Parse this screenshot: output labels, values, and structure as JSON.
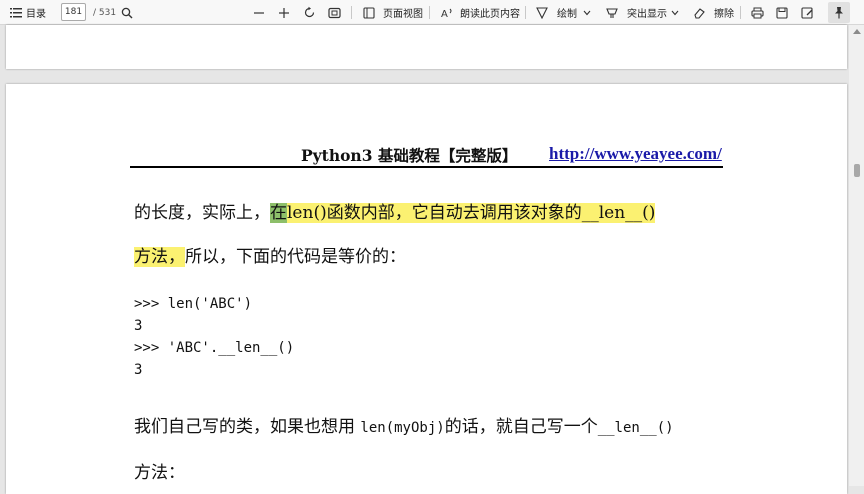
{
  "toolbar": {
    "toc_label": "目录",
    "current_page": "181",
    "total_pages": "/ 531",
    "page_view_label": "页面视图",
    "read_aloud_label": "朗读此页内容",
    "draw_label": "绘制",
    "highlight_label": "突出显示",
    "erase_label": "擦除"
  },
  "document": {
    "header_title": "Python3 基础教程【完整版】",
    "header_link": "http://www.yeayee.com/",
    "para1_a": "的长度，实际上，",
    "para1_hl_green": "在",
    "para1_hl_rest": "len()函数内部，它自动去调用该对象的__len__()",
    "para2_hl": "方法，",
    "para2_rest": "所以，下面的代码是等价的：",
    "code": [
      ">>> len('ABC')",
      "3",
      ">>> 'ABC'.__len__()",
      "3"
    ],
    "para3_a": "我们自己写的类，如果也想用 ",
    "para3_code": "len(myObj)",
    "para3_b": "的话，就自己写一个",
    "para3_code2": "__len__()",
    "para4": "方法："
  },
  "colors": {
    "highlight_yellow": "#fbf171",
    "highlight_green": "#8dbf6a",
    "link": "#1a1aa8"
  }
}
